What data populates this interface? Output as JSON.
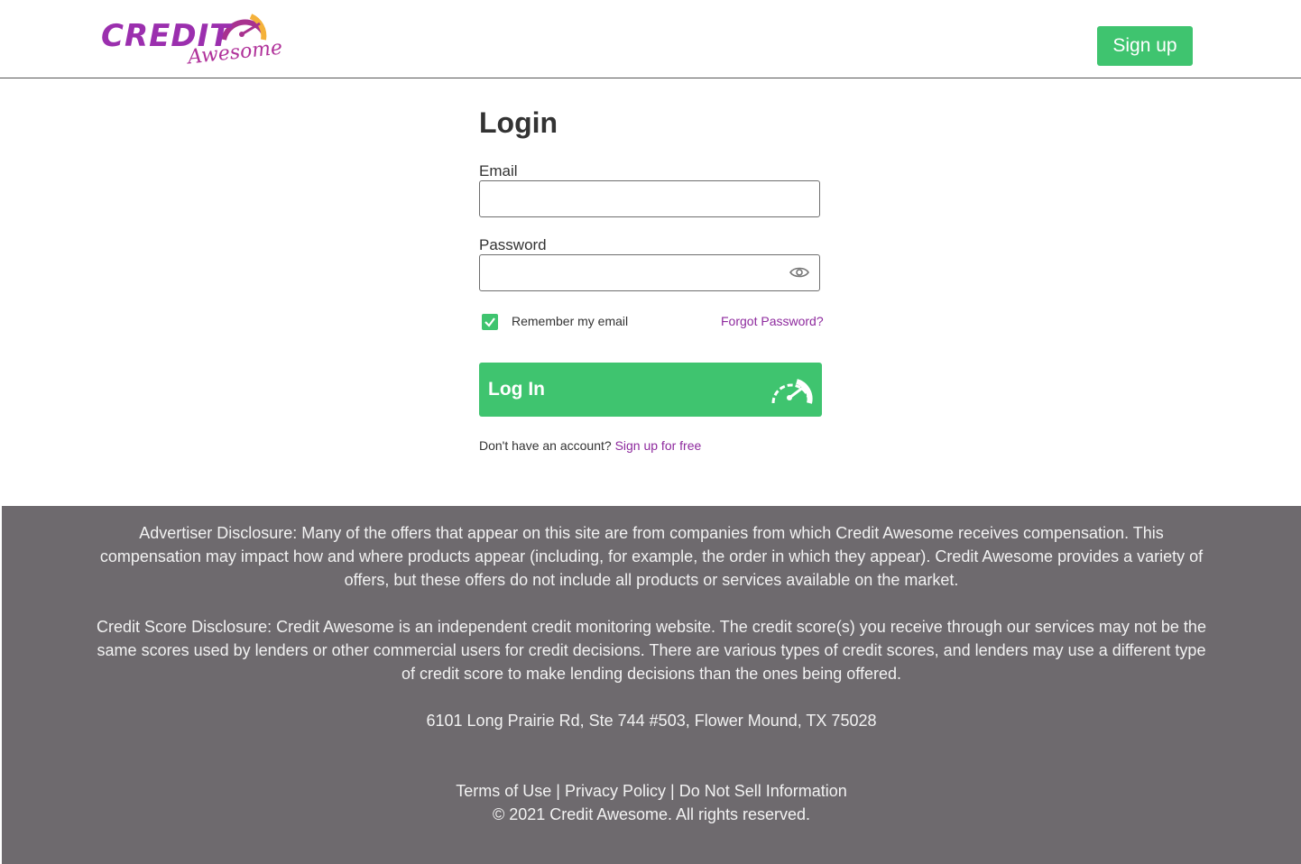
{
  "header": {
    "logo_credit": "CREDIT",
    "logo_awesome": "Awesome",
    "signup_label": "Sign up"
  },
  "login": {
    "title": "Login",
    "email_label": "Email",
    "email_value": "",
    "password_label": "Password",
    "password_value": "",
    "remember_label": "Remember my email",
    "remember_checked": true,
    "forgot_label": "Forgot Password?",
    "login_button": "Log In",
    "no_account_text": "Don't have an account?",
    "signup_free_link": "Sign up for free"
  },
  "footer": {
    "advertiser_disclosure": "Advertiser Disclosure:  Many of the offers that appear on this site are from companies from which Credit Awesome receives compensation. This compensation may impact how and where products appear (including, for example, the order in which they appear). Credit Awesome provides a variety of offers, but these offers do not include all products or services available on the market.",
    "credit_score_disclosure": "Credit Score Disclosure:  Credit Awesome is an independent credit monitoring website. The credit score(s) you receive through our services may not be the same scores used by lenders or other commercial users for credit decisions. There are various types of credit scores, and lenders may use a different type of credit score to make lending decisions than the ones being offered.",
    "address": "6101 Long Prairie Rd, Ste 744 #503, Flower Mound, TX 75028",
    "terms_link": "Terms of Use",
    "privacy_link": "Privacy Policy",
    "donotsell_link": "Do Not Sell Information",
    "separator": "|",
    "copyright": "© 2021 Credit Awesome. All rights reserved."
  },
  "colors": {
    "brand_green": "#3fc46f",
    "brand_purple": "#9b2fae",
    "footer_bg": "#6e6a6e"
  },
  "icons": [
    "speedometer-icon",
    "eye-icon",
    "checkmark-icon"
  ]
}
